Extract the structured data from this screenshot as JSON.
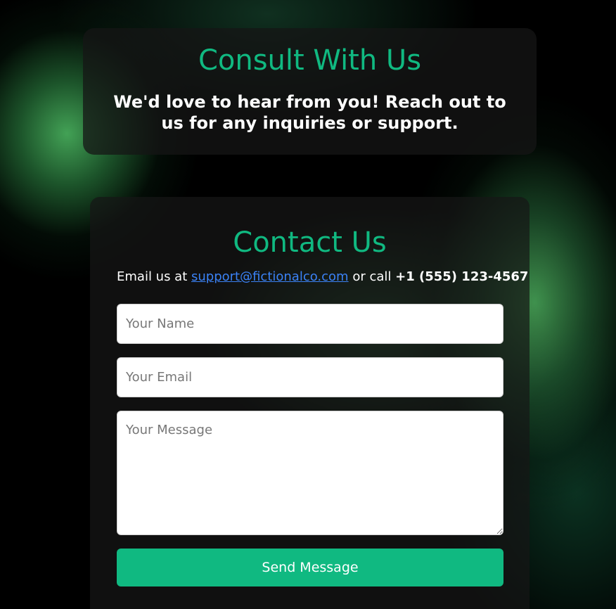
{
  "hero": {
    "title": "Consult With Us",
    "subtitle": "We'd love to hear from you! Reach out to us for any inquiries or support."
  },
  "contact": {
    "title": "Contact Us",
    "info_prefix": "Email us at ",
    "email": "support@fictionalco.com",
    "info_middle": " or call ",
    "phone": "+1 (555) 123-4567"
  },
  "form": {
    "name_placeholder": "Your Name",
    "email_placeholder": "Your Email",
    "message_placeholder": "Your Message",
    "submit_label": "Send Message"
  },
  "colors": {
    "accent": "#10b981",
    "link": "#3b82f6",
    "background": "#000000"
  }
}
